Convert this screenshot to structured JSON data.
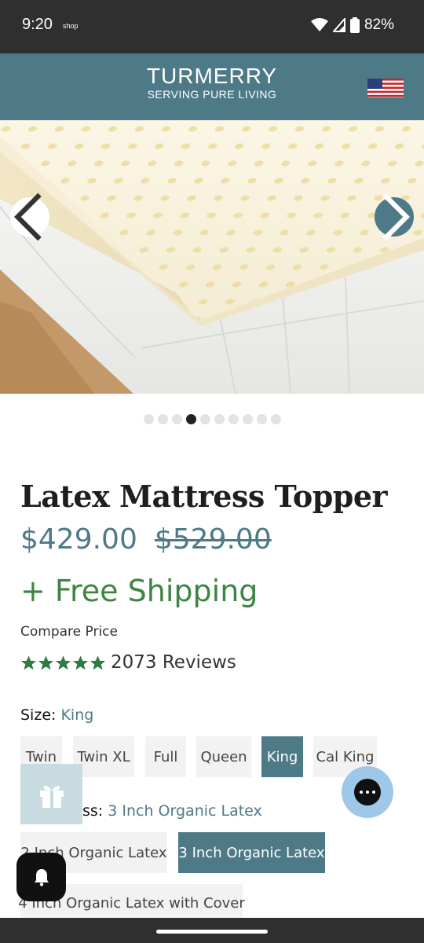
{
  "status_bar": {
    "time": "9:20",
    "app_label": "shop",
    "battery": "82%"
  },
  "header": {
    "brand": "TURMERRY",
    "tagline": "SERVING PURE LIVING",
    "flag_icon": "us-flag-icon"
  },
  "gallery": {
    "slide_count": 10,
    "active_index": 3
  },
  "product": {
    "title": "Latex Mattress Topper",
    "price": "$429.00",
    "compare_at_price": "$529.00",
    "shipping_note": "+ Free Shipping",
    "compare_label": "Compare Price",
    "rating": 5,
    "reviews_label": "2073 Reviews"
  },
  "size": {
    "label": "Size:",
    "selected": "King",
    "options": [
      "Twin",
      "Twin XL",
      "Full",
      "Queen",
      "King",
      "Cal King"
    ]
  },
  "thickness": {
    "label": "Thickness:",
    "label_visible": "ss:",
    "selected": "3 Inch Organic Latex",
    "options": [
      "2 Inch Organic Latex",
      "3 Inch Organic Latex",
      "4 Inch Organic Latex with Cover"
    ]
  },
  "colors": {
    "brand": "#4e7a87",
    "shipping_green": "#3d8540",
    "star_green": "#2e7d3f"
  }
}
